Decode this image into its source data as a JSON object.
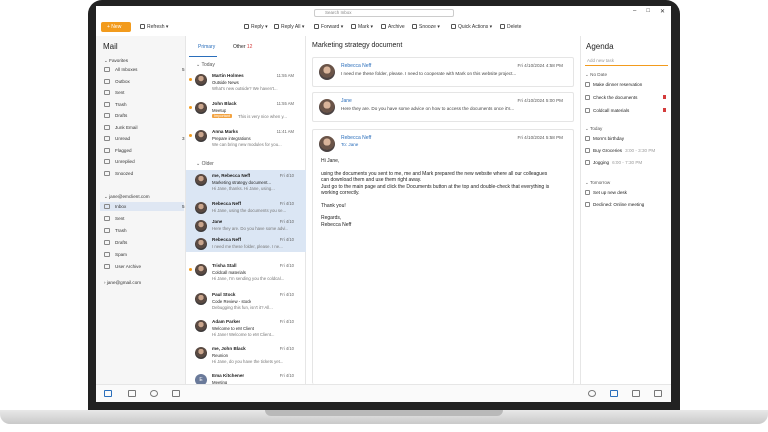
{
  "toolbar": {
    "new": "+ New",
    "refresh": "Refresh",
    "reply": "Reply",
    "reply_all": "Reply All",
    "forward": "Forward",
    "mark": "Mark",
    "archive": "Archive",
    "snooze": "Snooze",
    "quick_actions": "Quick Actions",
    "delete": "Delete",
    "search_placeholder": "Search Inbox"
  },
  "sidebar": {
    "title": "Mail",
    "favorites": {
      "label": "Favorites",
      "items": [
        {
          "label": "All Inboxes",
          "count": "5"
        },
        {
          "label": "Outbox",
          "count": ""
        },
        {
          "label": "Sent",
          "count": ""
        },
        {
          "label": "Trash",
          "count": ""
        },
        {
          "label": "Drafts",
          "count": ""
        },
        {
          "label": "Junk Email",
          "count": ""
        },
        {
          "label": "Unread",
          "count": "3"
        },
        {
          "label": "Flagged",
          "count": ""
        },
        {
          "label": "Unreplied",
          "count": ""
        },
        {
          "label": "Snoozed",
          "count": ""
        }
      ]
    },
    "account1": {
      "label": "jane@emclient.com",
      "items": [
        {
          "label": "Inbox",
          "count": "5"
        },
        {
          "label": "Sent",
          "count": ""
        },
        {
          "label": "Trash",
          "count": ""
        },
        {
          "label": "Drafts",
          "count": ""
        },
        {
          "label": "Spam",
          "count": ""
        },
        {
          "label": "User Archive",
          "count": ""
        }
      ]
    },
    "account2": {
      "label": "jane@gmail.com"
    }
  },
  "list": {
    "tab_primary": "Primary",
    "tab_other": "Other",
    "other_badge": "12",
    "today": "Today",
    "older": "Older",
    "today_items": [
      {
        "name": "Martin Holmes",
        "subject": "Outside News",
        "preview": "What's new outside? We haven't...",
        "time": "11:55 AM"
      },
      {
        "name": "John Black",
        "subject": "Meetup",
        "preview": "This is very nice when y...",
        "tag": "Important",
        "time": "11:55 AM"
      },
      {
        "name": "Anna Marks",
        "subject": "Prepare integrations",
        "preview": "We can bring new modules for you...",
        "time": "11:41 AM"
      }
    ],
    "older_items": [
      {
        "name": "me, Rebecca Neff",
        "subject": "Marketing strategy document...",
        "preview": "Hi Jane, thanks. Hi Jane, using...",
        "time": "Fri 4/10"
      },
      {
        "name": "Rebecca Neff",
        "subject": "",
        "preview": "Hi Jane, using the documents you se...",
        "time": "Fri 4/10"
      },
      {
        "name": "Jane",
        "subject": "",
        "preview": "Here they are. Do you have some advi...",
        "time": "Fri 4/10"
      },
      {
        "name": "Rebecca Neff",
        "subject": "",
        "preview": "I need me these folder, please. I ne...",
        "time": "Fri 4/10"
      },
      {
        "name": "Trisha Stall",
        "subject": "Coldcall materials",
        "preview": "Hi Jane, I'm sending you the coldcal...",
        "time": "Fri 4/10"
      },
      {
        "name": "Paul Stock",
        "subject": "Code Review - stock",
        "preview": "Debugging this fun, isn't it? All...",
        "time": "Fri 4/10"
      },
      {
        "name": "Adam Parker",
        "subject": "Welcome to eM Client",
        "preview": "Hi Jane! Welcome to eM Client...",
        "time": "Fri 4/10"
      },
      {
        "name": "me, John Black",
        "subject": "Reunion",
        "preview": "Hi Jane, do you have the tickets yet...",
        "time": "Fri 4/10"
      },
      {
        "name": "Ema Kitchener",
        "subject": "Meeting",
        "preview": "See you then, I'll be looking forward...",
        "time": "Fri 4/10"
      }
    ]
  },
  "reader": {
    "subject": "Marketing strategy document",
    "messages": [
      {
        "from": "Rebecca Neff",
        "date": "Fri 4/10/2024 4:58 PM",
        "preview": "I need me these folder, please. I need to cooperate with Mark on this website project..."
      },
      {
        "from": "Jane",
        "date": "Fri 4/10/2024 5:00 PM",
        "preview": "Here they are. Do you have some advice on how to access the documents once it's..."
      }
    ],
    "open": {
      "from": "Rebecca Neff",
      "date": "Fri 4/10/2024 5:58 PM",
      "to": "To: Jane",
      "body": [
        "Hi Jane,",
        "using the documents you sent to me, me and Mark prepared the new website where all our colleagues can download them and use them right away.",
        "Just go to the main page and click the Documents button at the top and double-check that everything is working correctly.",
        "Thank you!",
        "Regards,",
        "Rebecca Neff"
      ]
    }
  },
  "agenda": {
    "title": "Agenda",
    "add_task": "Add new task",
    "no_date": "No Date",
    "no_date_items": [
      "Make dinner reservation",
      "Check the documents",
      "Coldcall materials"
    ],
    "today": "Today",
    "today_items": [
      {
        "label": "Mom's birthday",
        "time": ""
      },
      {
        "label": "Buy Groceries",
        "time": "3:00 - 3:30 PM"
      },
      {
        "label": "Jogging",
        "time": "6:00 - 7:30 PM"
      }
    ],
    "tomorrow": "Tomorrow",
    "tomorrow_items": [
      "Set up new desk",
      "Declined: Online meeting"
    ]
  },
  "colors": {
    "accent": "#f29b1d",
    "link": "#2a6ebb",
    "selection": "#dbe6f4"
  }
}
